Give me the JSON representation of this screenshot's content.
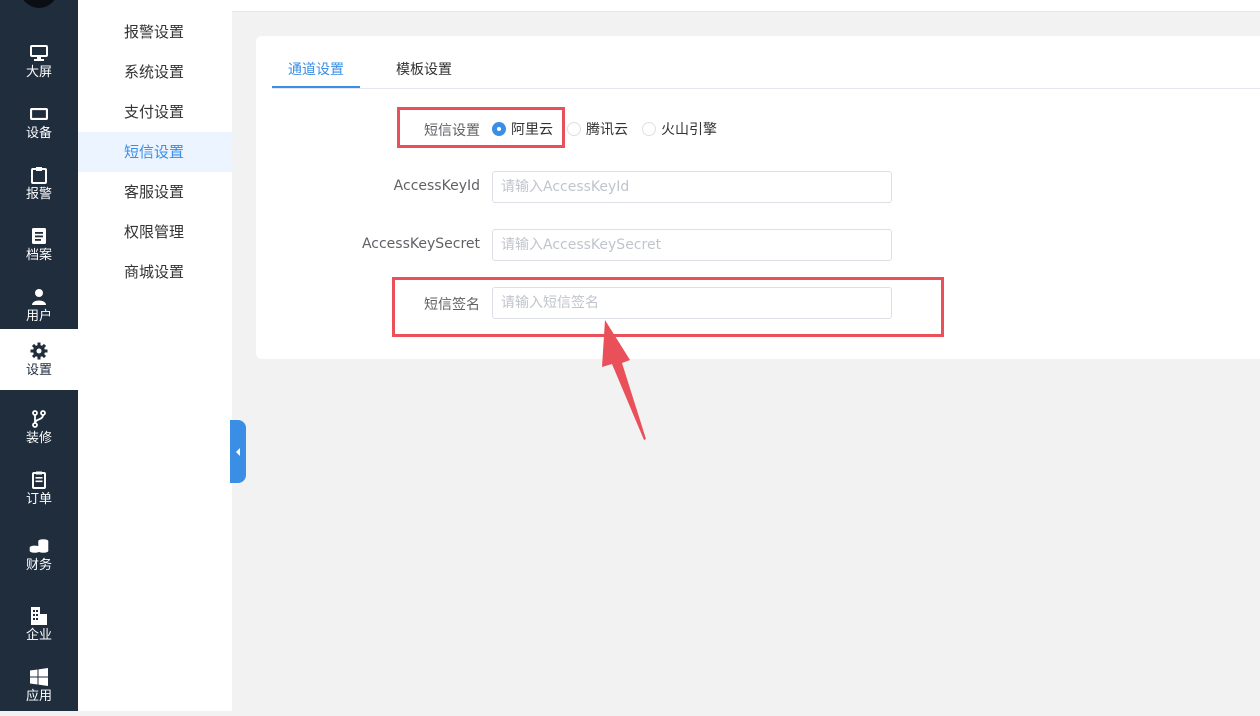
{
  "rail": {
    "items": [
      {
        "label": "大屏",
        "icon": "monitor-icon"
      },
      {
        "label": "设备",
        "icon": "device-icon"
      },
      {
        "label": "报警",
        "icon": "clipboard-icon"
      },
      {
        "label": "档案",
        "icon": "document-icon"
      },
      {
        "label": "用户",
        "icon": "user-icon"
      },
      {
        "label": "设置",
        "icon": "gear-icon"
      },
      {
        "label": "装修",
        "icon": "branch-icon"
      },
      {
        "label": "订单",
        "icon": "order-icon"
      },
      {
        "label": "财务",
        "icon": "coins-icon"
      },
      {
        "label": "企业",
        "icon": "building-icon"
      },
      {
        "label": "应用",
        "icon": "windows-icon"
      }
    ],
    "active": "设置"
  },
  "submenu": {
    "items": [
      "报警设置",
      "系统设置",
      "支付设置",
      "短信设置",
      "客服设置",
      "权限管理",
      "商城设置"
    ],
    "active": "短信设置"
  },
  "tabs": [
    "通道设置",
    "模板设置"
  ],
  "form": {
    "sms_label": "短信设置",
    "providers": [
      "阿里云",
      "腾讯云",
      "火山引擎"
    ],
    "selected_provider": "阿里云",
    "access_key_id": {
      "label": "AccessKeyId",
      "placeholder": "请输入AccessKeyId",
      "value": ""
    },
    "access_key_secret": {
      "label": "AccessKeySecret",
      "placeholder": "请输入AccessKeySecret",
      "value": ""
    },
    "sign_name": {
      "label": "短信签名",
      "placeholder": "请输入短信签名",
      "value": ""
    }
  },
  "colors": {
    "rail_bg": "#1f2d3d",
    "accent": "#3a8ee6",
    "annotation": "#e9505a"
  }
}
